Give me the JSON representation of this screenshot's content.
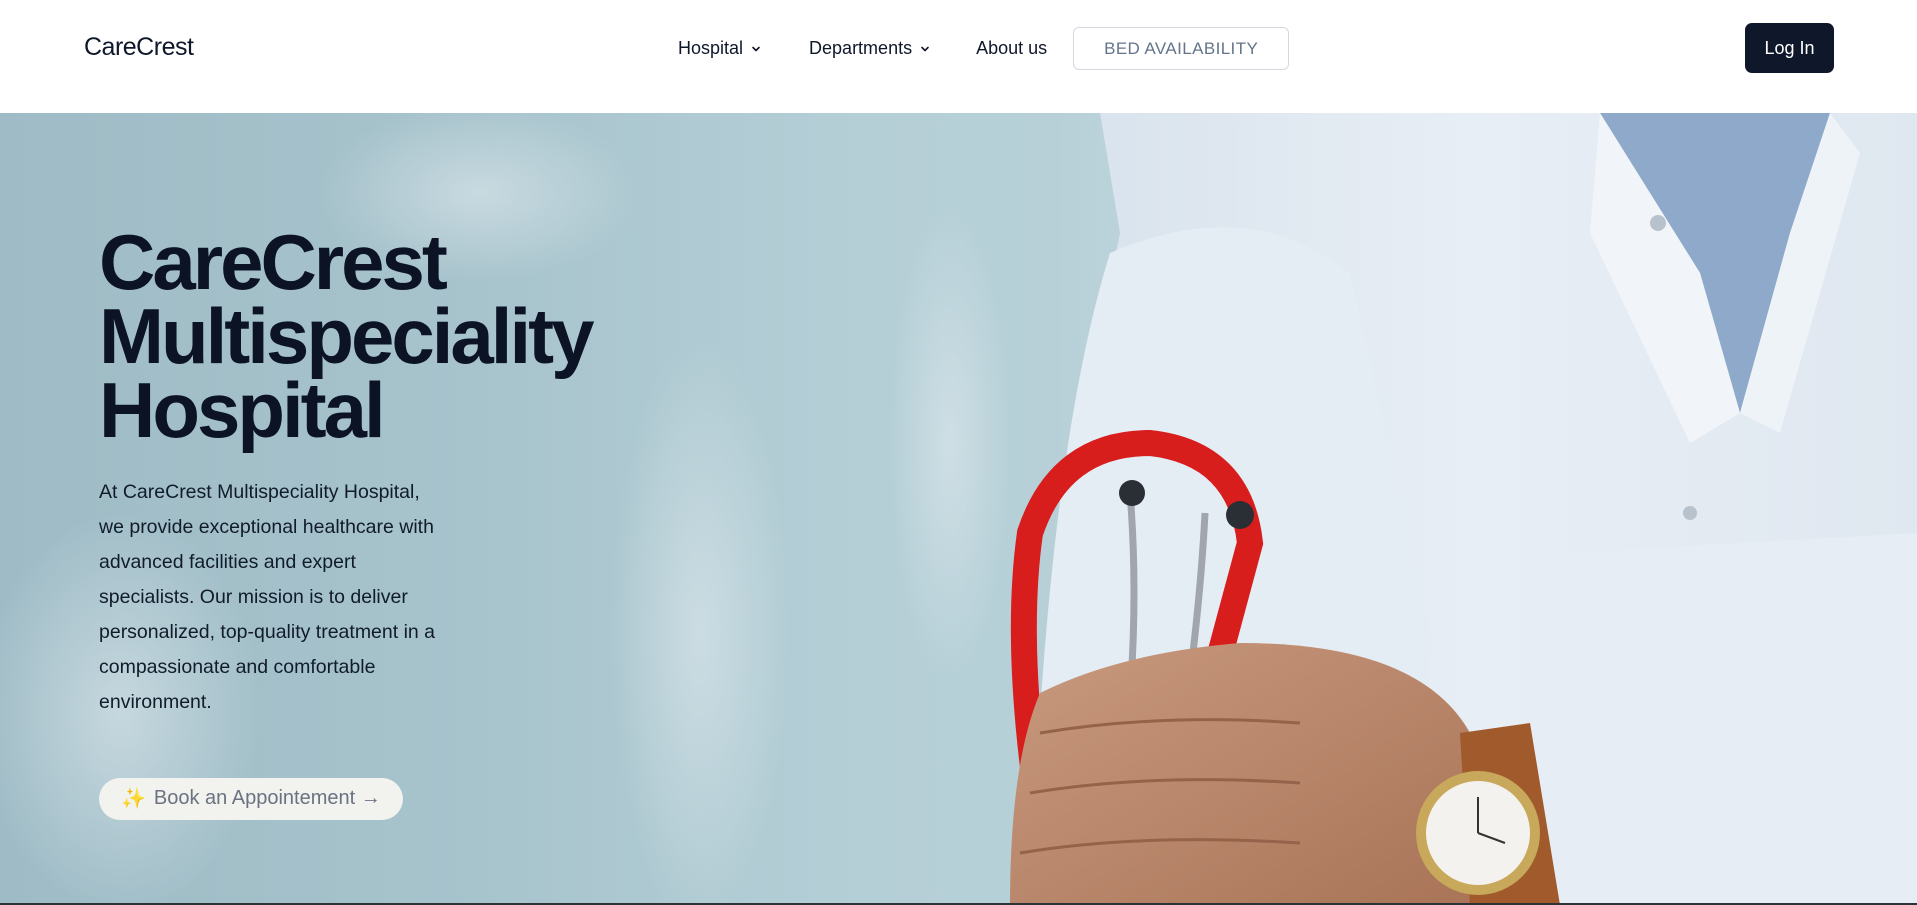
{
  "header": {
    "brand": "CareCrest",
    "nav": [
      {
        "label": "Hospital",
        "has_dropdown": true
      },
      {
        "label": "Departments",
        "has_dropdown": true
      },
      {
        "label": "About us",
        "has_dropdown": false
      }
    ],
    "bed_availability_label": "BED AVAILABILITY",
    "login_label": "Log In"
  },
  "hero": {
    "title_lines": [
      "CareCrest",
      "Multispeciality",
      "Hospital"
    ],
    "description": "At CareCrest Multispeciality Hospital, we provide exceptional healthcare with advanced facilities and expert specialists. Our mission is to deliver personalized, top-quality treatment in a compassionate and comfortable environment.",
    "cta_icon": "✨",
    "cta_label": "Book an Appointement →"
  },
  "colors": {
    "primary_dark": "#0f172a",
    "stethoscope_red": "#d81d1d",
    "hero_bg": "#a7c3cc"
  },
  "icons": [
    "chevron-down-icon",
    "sparkle-icon",
    "arrow-right-icon"
  ]
}
